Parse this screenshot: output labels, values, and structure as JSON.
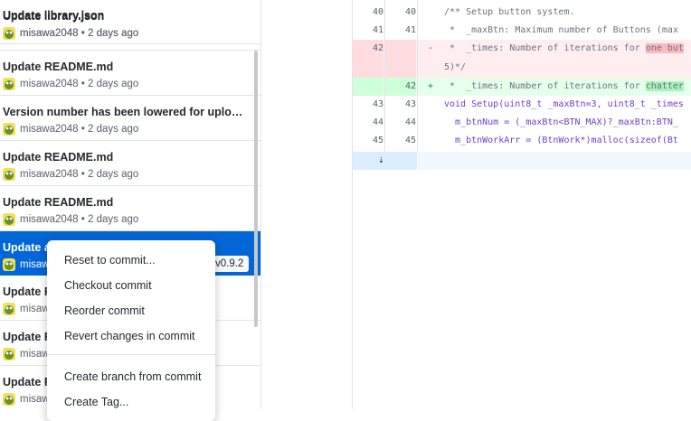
{
  "commits": [
    {
      "summary": "Update library.json",
      "author": "misawa2048",
      "when": "2 days ago"
    },
    {
      "summary": "Update README.md",
      "author": "misawa2048",
      "when": "2 days ago"
    },
    {
      "summary": "Version number has been lowered for uploadin...",
      "author": "misawa2048",
      "when": "2 days ago"
    },
    {
      "summary": "Update README.md",
      "author": "misawa2048",
      "when": "2 days ago"
    },
    {
      "summary": "Update README.md",
      "author": "misawa2048",
      "when": "2 days ago"
    },
    {
      "summary": "Update a",
      "author": "misaw",
      "when": "",
      "tag": "v0.9.2"
    },
    {
      "summary": "Update R",
      "author": "misaw",
      "when": ""
    },
    {
      "summary": "Update R",
      "author": "misaw",
      "when": ""
    },
    {
      "summary": "Update R",
      "author": "misaw",
      "when": ""
    }
  ],
  "context_menu": {
    "items": [
      "Reset to commit...",
      "Checkout commit",
      "Reorder commit",
      "Revert changes in commit",
      "Create branch from commit",
      "Create Tag..."
    ]
  },
  "diff": {
    "lines": [
      {
        "old": "40",
        "new": "40",
        "marker": "",
        "type": "ctx",
        "code": "/** Setup button system."
      },
      {
        "old": "41",
        "new": "41",
        "marker": "",
        "type": "ctx",
        "code": " *  _maxBtn: Maximum number of Buttons (max"
      },
      {
        "old": "42",
        "new": "",
        "marker": "-",
        "type": "del",
        "code_pre": " *  _times: Number of iterations for ",
        "code_hl": "one but",
        "code_post": ""
      },
      {
        "old": "",
        "new": "",
        "marker": "",
        "type": "del",
        "code": "5)*/"
      },
      {
        "old": "",
        "new": "42",
        "marker": "+",
        "type": "add",
        "code_pre": " *  _times: Number of iterations for ",
        "code_hl": "chatter",
        "code_post": ""
      },
      {
        "old": "43",
        "new": "43",
        "marker": "",
        "type": "ctx",
        "code": "void Setup(uint8_t _maxBtn=3, uint8_t _times"
      },
      {
        "old": "44",
        "new": "44",
        "marker": "",
        "type": "ctx",
        "code": "  m_btnNum = (_maxBtn<BTN_MAX)?_maxBtn:BTN_"
      },
      {
        "old": "45",
        "new": "45",
        "marker": "",
        "type": "ctx",
        "code": "  m_btnWorkArr = (BtnWork*)malloc(sizeof(Bt"
      }
    ],
    "expander_icon": "expand-down-icon"
  },
  "colors": {
    "selected": "#0366d6",
    "deleted": "#ffeef0",
    "added": "#e6ffed"
  }
}
